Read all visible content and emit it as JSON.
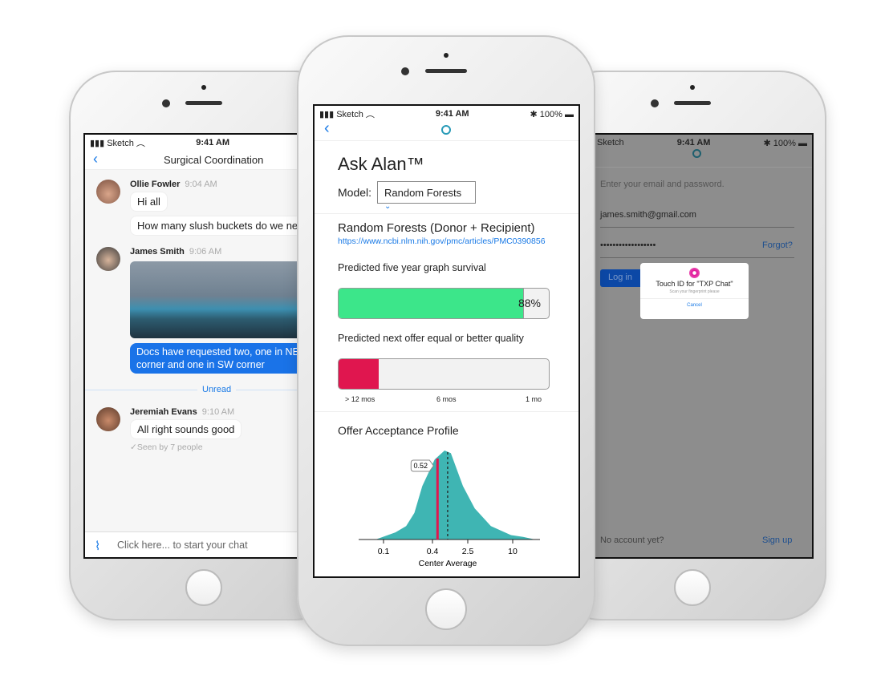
{
  "status_bar": {
    "carrier": "Sketch",
    "time": "9:41 AM",
    "battery": "100%"
  },
  "chat": {
    "title": "Surgical Coordination",
    "messages": [
      {
        "author": "Ollie Fowler",
        "time": "9:04 AM",
        "texts": [
          "Hi all",
          "How many slush buckets do we need?"
        ]
      },
      {
        "author": "James Smith",
        "time": "9:06 AM",
        "image": "operating-room-photo",
        "text": "Docs have requested two, one in NE corner and one in SW corner"
      },
      {
        "author": "Jeremiah Evans",
        "time": "9:10 AM",
        "texts": [
          "All right sounds good"
        ],
        "seen": "Seen by 7 people"
      }
    ],
    "unread_label": "Unread",
    "input_placeholder": "Click here... to start your chat"
  },
  "ask_alan": {
    "title": "Ask Alan™",
    "model_label": "Model:",
    "model_value": "Random Forests",
    "model_name": "Random Forests (Donor + Recipient)",
    "model_link": "https://www.ncbi.nlm.nih.gov/pmc/articles/PMC0390856",
    "survival_label": "Predicted five year graph survival",
    "survival_value": "88%",
    "survival_fraction": 0.88,
    "offer_label": "Predicted next offer equal or better quality",
    "offer_fraction": 0.19,
    "offer_ticks": [
      "> 12 mos",
      "6 mos",
      "1 mo"
    ],
    "colors": {
      "survival": "#3ce68a",
      "offer": "#e0164f",
      "density": "#3fb5b3",
      "link": "#1a7ae6"
    }
  },
  "chart_data": {
    "type": "area",
    "title": "Offer Acceptance Profile",
    "xlabel": "Center Average",
    "x_scale": "log",
    "x_ticks": [
      0.1,
      0.4,
      2.5,
      10
    ],
    "x_tick_labels": [
      "0.1",
      "0.4",
      "2.5",
      "10"
    ],
    "marker": {
      "value": 0.52,
      "label": "0.52",
      "color": "#e0164f"
    },
    "median_dashed": 0.88,
    "x": [
      0.08,
      0.14,
      0.19,
      0.24,
      0.3,
      0.45,
      0.75,
      1.04,
      1.95,
      3.1,
      5.1,
      9.5,
      13.8,
      20
    ],
    "density": [
      0,
      0.08,
      0.15,
      0.3,
      0.6,
      0.9,
      1.0,
      0.97,
      0.6,
      0.35,
      0.15,
      0.05,
      0.03,
      0
    ],
    "color": "#3fb5b3",
    "grid": false
  },
  "login": {
    "prompt": "Enter your email and password.",
    "email": "james.smith@gmail.com",
    "password": "••••••••••••••••••",
    "forgot": "Forgot?",
    "login_button": "Log in",
    "touchid_title": "Touch ID for \"TXP Chat\"",
    "touchid_subtitle": "Scan your fingerprint please",
    "touchid_cancel": "Cancel",
    "no_account": "No account yet?",
    "signup": "Sign up"
  }
}
